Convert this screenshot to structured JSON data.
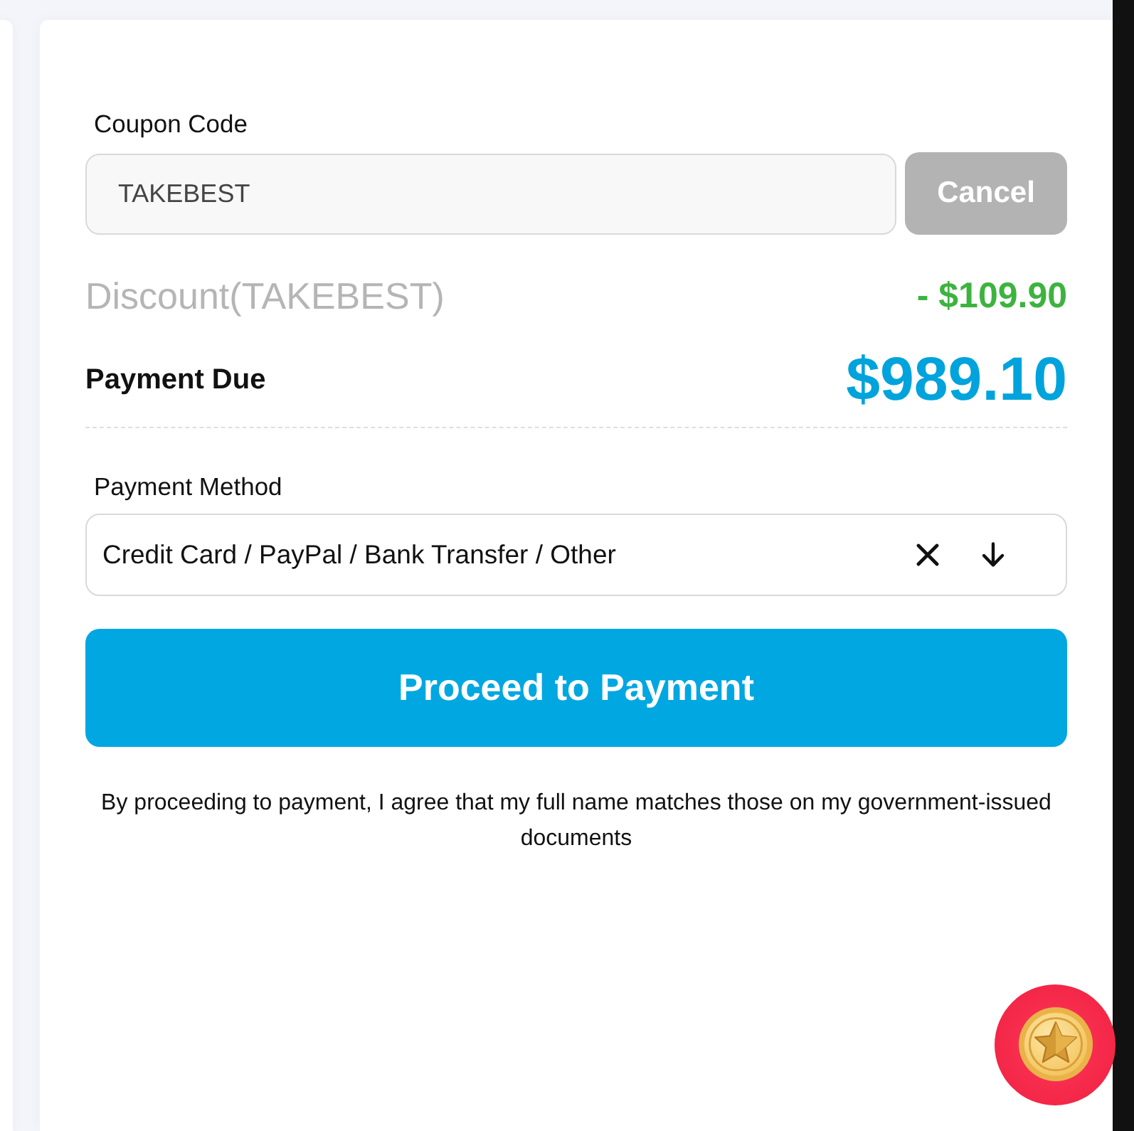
{
  "coupon": {
    "label": "Coupon Code",
    "value": "TAKEBEST",
    "button": "Cancel"
  },
  "summary": {
    "discount_label": "Discount(TAKEBEST)",
    "discount_amount": "- $109.90",
    "due_label": "Payment Due",
    "due_amount": "$989.10"
  },
  "payment_method": {
    "label": "Payment Method",
    "value": "Credit Card / PayPal / Bank Transfer / Other"
  },
  "proceed_button": "Proceed to Payment",
  "disclaimer": "By proceeding to payment, I agree that my full name matches those on my government-issued documents"
}
